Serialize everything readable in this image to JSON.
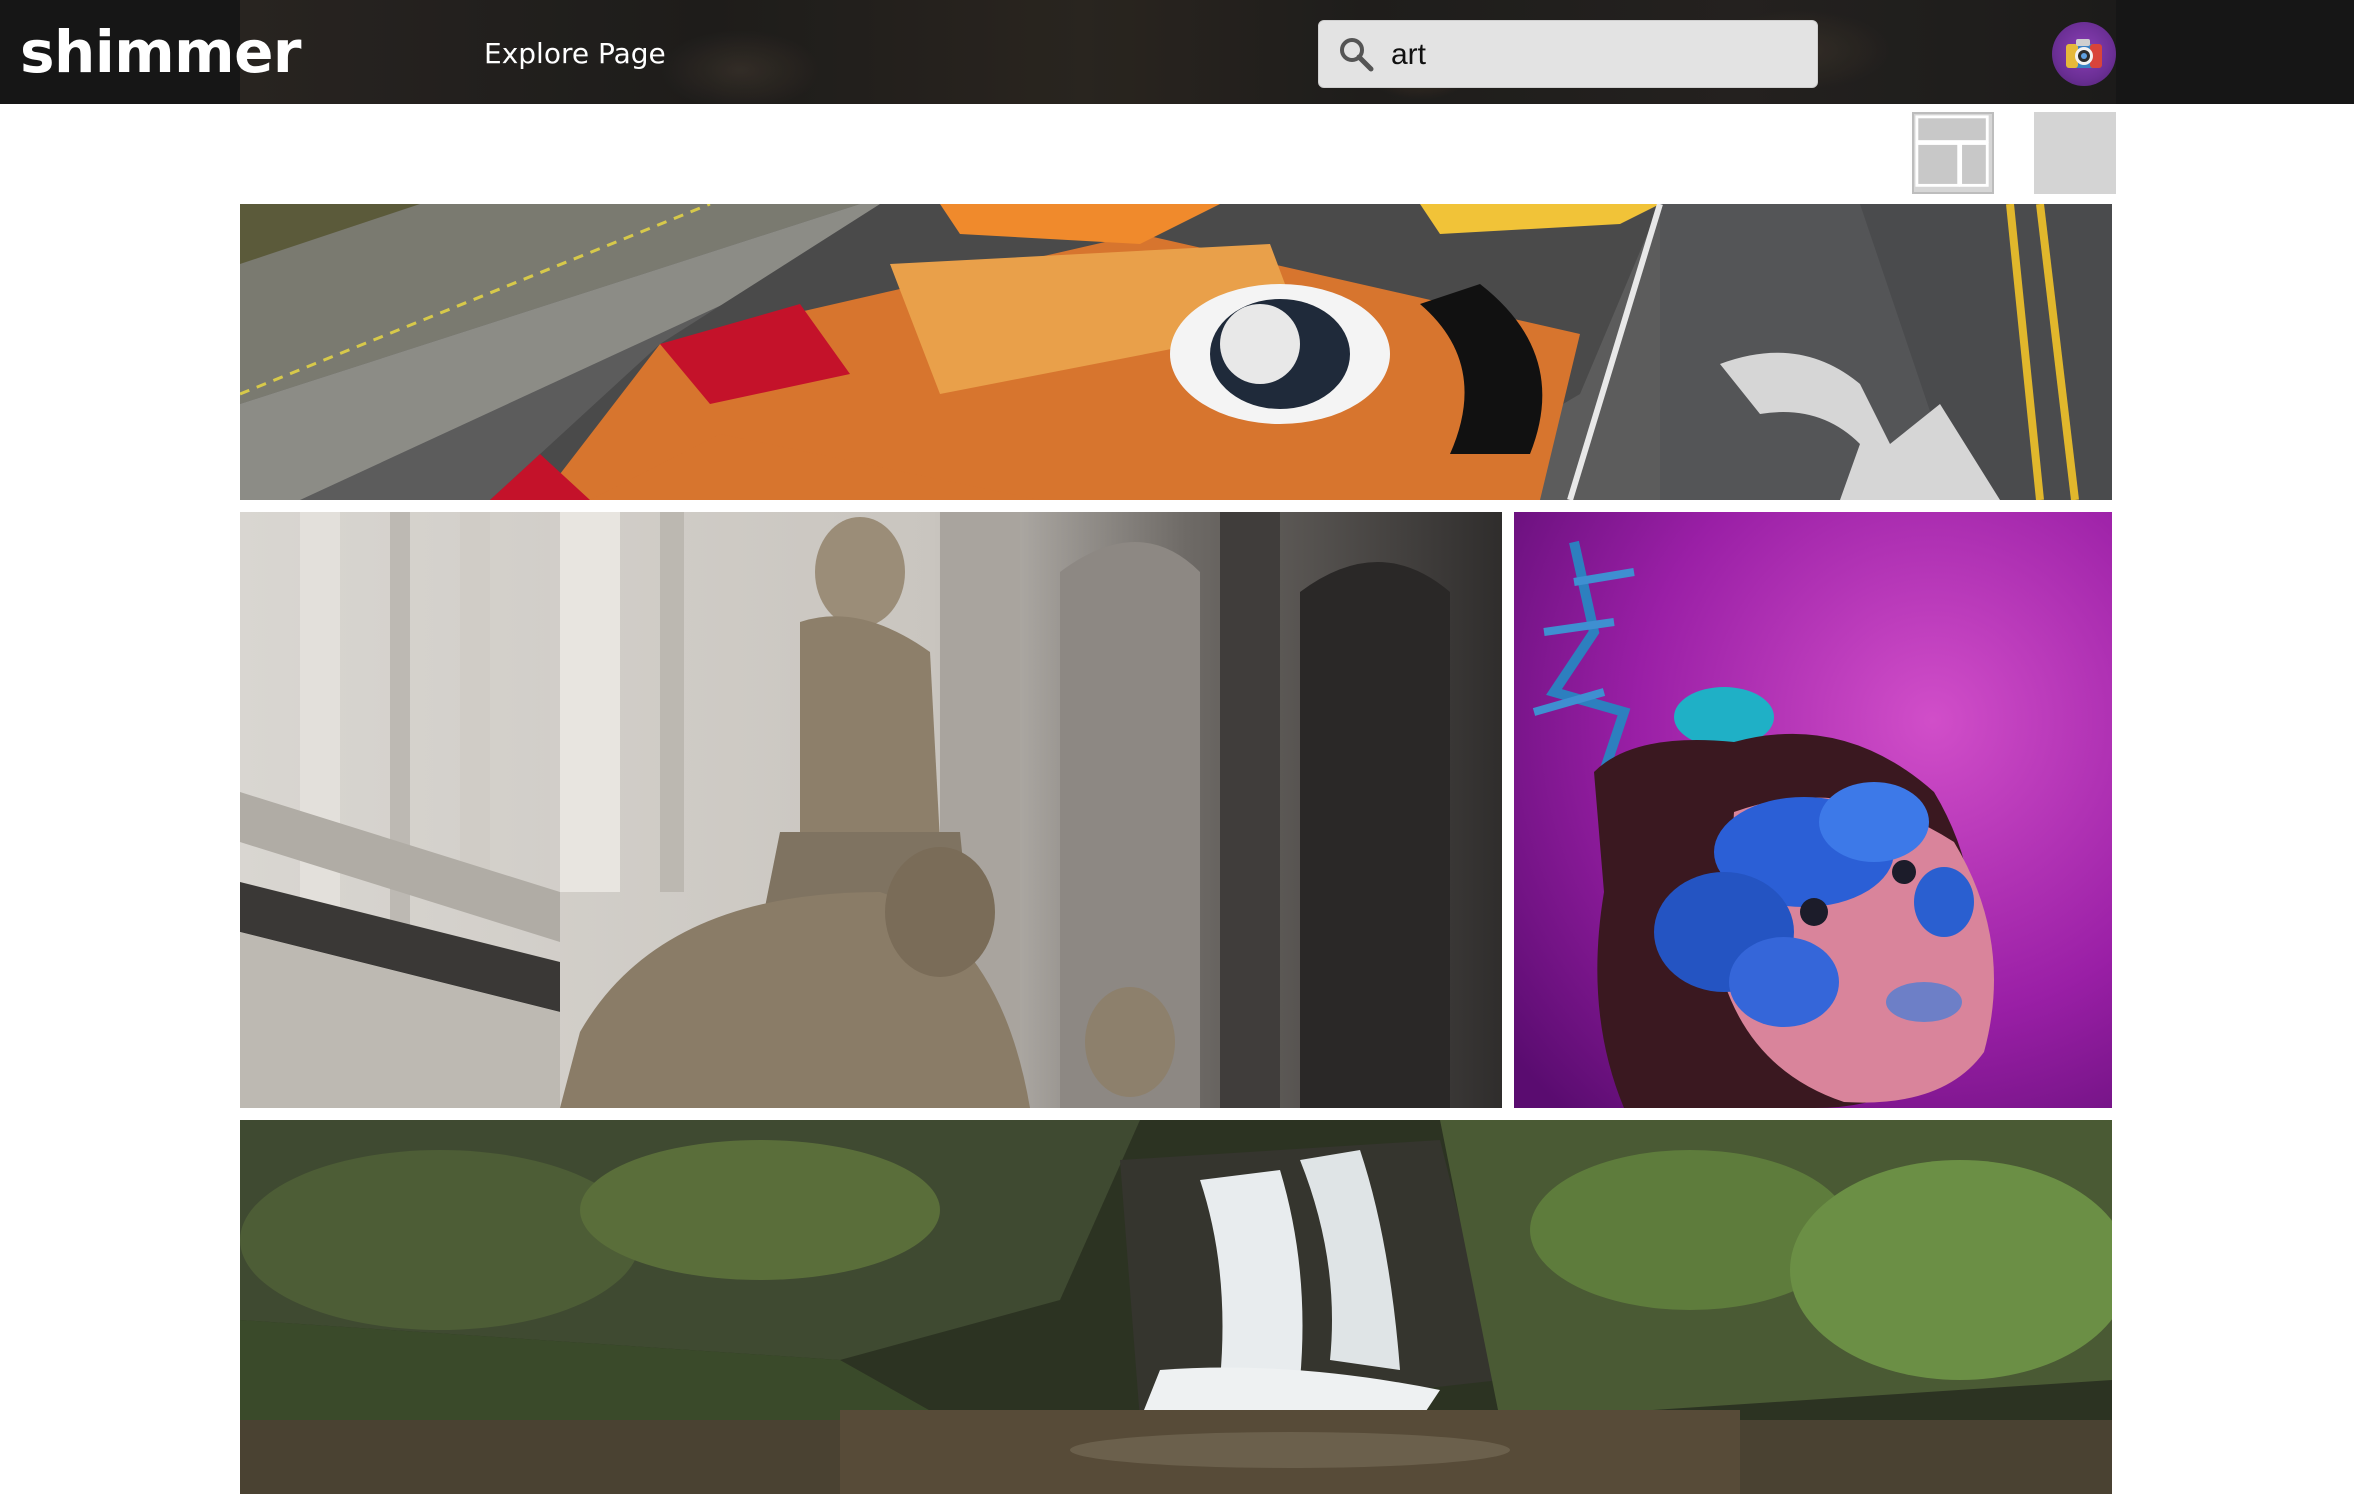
{
  "header": {
    "brand": "shimmer",
    "nav_label": "Explore Page",
    "search": {
      "value": "art",
      "icon": "search-icon"
    },
    "avatar_icon": "camera-avatar-icon"
  },
  "view_toggles": [
    {
      "name": "grid-layout",
      "icon": "grid-layout-icon"
    },
    {
      "name": "single-layout",
      "icon": "single-layout-icon"
    }
  ],
  "photos": [
    {
      "subject": "street-chalk-art-photo"
    },
    {
      "subject": "marble-sculpture-photo"
    },
    {
      "subject": "floral-face-paint-portrait-photo"
    },
    {
      "subject": "forest-waterfall-photo"
    }
  ],
  "colors": {
    "header_bg": "#161616",
    "search_bg": "#e3e3e3",
    "toggle_bg": "#d4d4d4",
    "avatar": "#7a35a8"
  }
}
